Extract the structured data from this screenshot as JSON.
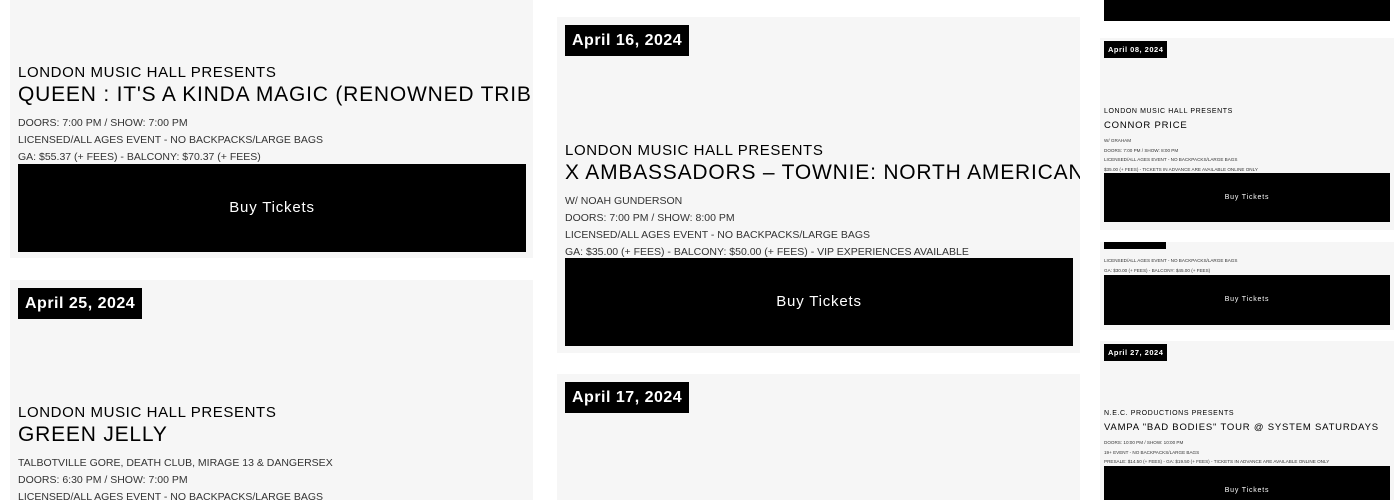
{
  "events": [
    {
      "date": "",
      "presenter": "London Music Hall Presents",
      "title": "Queen : It's A Kinda Magic (Renowned Tribute Act)",
      "info": [
        "Doors: 7:00 PM / Show: 7:00 PM",
        "Licensed/All Ages Event - No Backpacks/Large Bags",
        "GA: $55.37 (+ Fees) - Balcony: $70.37 (+ Fees)"
      ],
      "buy_label": "Buy Tickets"
    },
    {
      "date": "April 25, 2024",
      "presenter": "London Music Hall Presents",
      "title": "Green Jelly",
      "info": [
        "Talbotville Gore, Death Club, Mirage 13 & Dangersex",
        "Doors: 6:30 PM / Show: 7:00 PM",
        "Licensed/All Ages Event - No Backpacks/Large Bags"
      ]
    },
    {
      "date": "April 16, 2024",
      "presenter": "London Music Hall Presents",
      "title": "X Ambassadors – Townie: North American Tour",
      "info": [
        "w/ Noah Gunderson",
        "Doors: 7:00 PM / Show: 8:00 PM",
        "Licensed/All Ages Event - No Backpacks/Large Bags",
        "GA: $35.00 (+ Fees) - Balcony: $50.00 (+ Fees) - VIP Experiences Available"
      ],
      "buy_label": "Buy Tickets"
    },
    {
      "date": "April 17, 2024"
    }
  ],
  "side_events": [
    {
      "date": "April 08, 2024",
      "presenter": "London Music Hall Presents",
      "title": "Connor Price",
      "info": [
        "w/ Graham",
        "Doors: 7:00 PM / Show: 8:00 PM",
        "Licensed/All Ages Event - No Backpacks/Large Bags",
        "$35.00 (+ Fees) - Tickets in advance are available online only"
      ],
      "buy_label": "Buy Tickets"
    },
    {
      "info": [
        "Licensed/All Ages Event - No Backpacks/Large Bags",
        "GA: $30.00 (+ Fees) - Balcony: $45.00 (+ Fees)"
      ],
      "buy_label": "Buy Tickets"
    },
    {
      "date": "April 27, 2024",
      "presenter": "N.E.C. Productions Presents",
      "title": "Vampa \"Bad Bodies\" Tour @ System Saturdays",
      "info": [
        "Doors: 10:00 PM / Show: 10:00 PM",
        "19+ Event - No Backpacks/Large Bags",
        "Presale: $14.50 (+ Fees) - GA: $19.50 (+ Fees) - Tickets in advance are available online only"
      ],
      "buy_label": "Buy Tickets"
    }
  ]
}
